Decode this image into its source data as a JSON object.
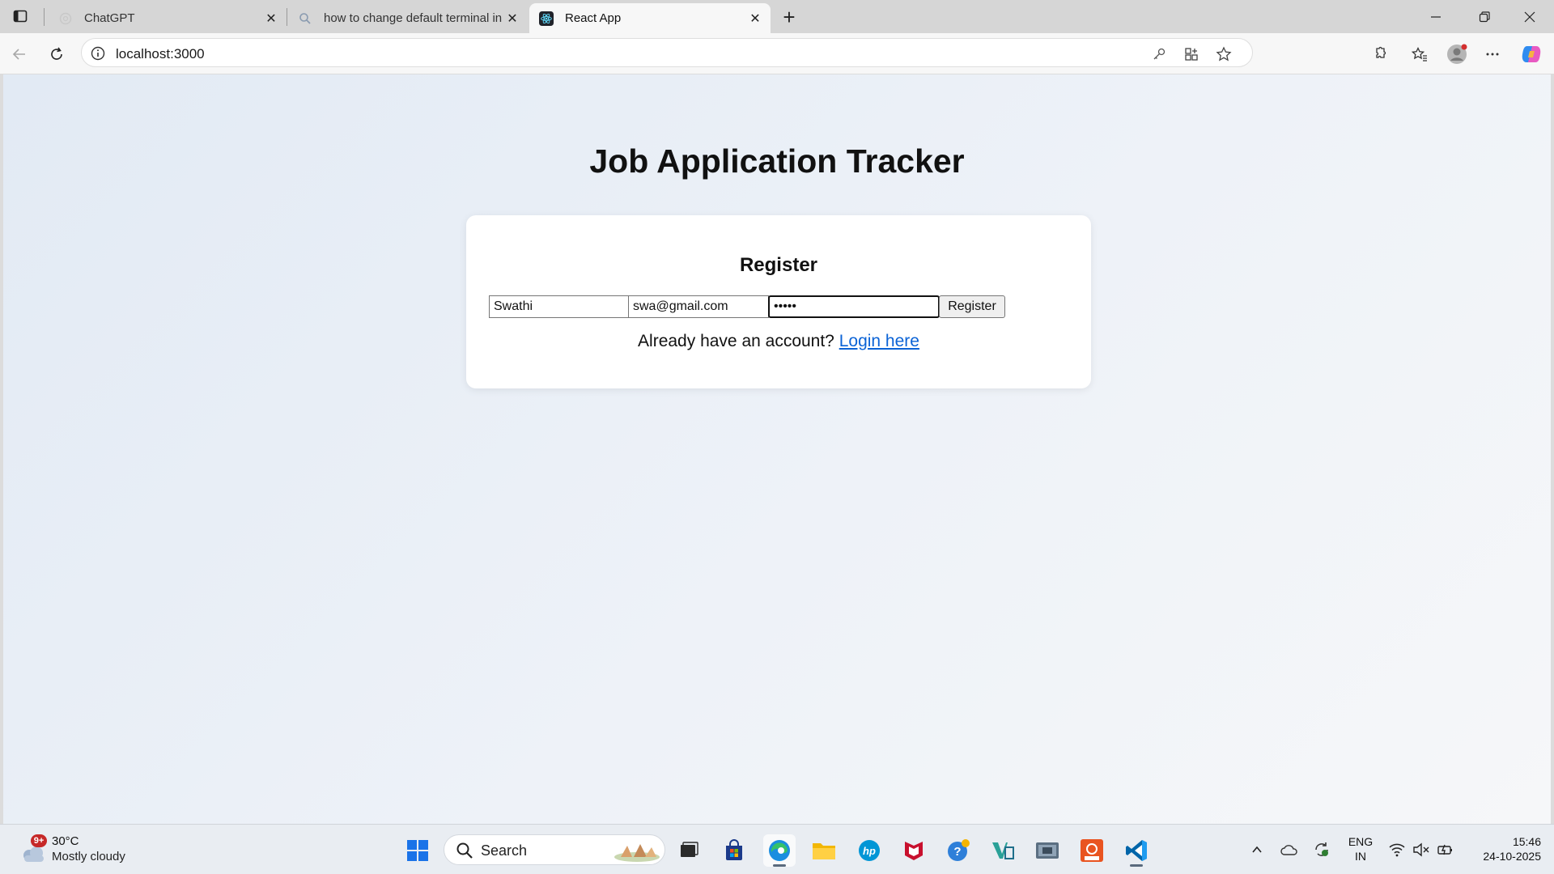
{
  "browser": {
    "tabs": [
      {
        "title": "ChatGPT"
      },
      {
        "title": "how to change default terminal in"
      },
      {
        "title": "React App"
      }
    ],
    "url": "localhost:3000"
  },
  "page": {
    "title": "Job Application Tracker",
    "form": {
      "heading": "Register",
      "name_value": "Swathi",
      "email_value": "swa@gmail.com",
      "password_value": "•••••",
      "submit_label": "Register",
      "login_prompt": "Already have an account?",
      "login_link": "Login here"
    }
  },
  "taskbar": {
    "weather": {
      "badge": "9+",
      "temp": "30°C",
      "condition": "Mostly cloudy"
    },
    "search_label": "Search",
    "lang_primary": "ENG",
    "lang_secondary": "IN",
    "time": "15:46",
    "date": "24-10-2025"
  },
  "colors": {
    "link": "#0b63d6",
    "viewport_bg_start": "#e2eaf4",
    "viewport_bg_end": "#f6f7f9"
  }
}
